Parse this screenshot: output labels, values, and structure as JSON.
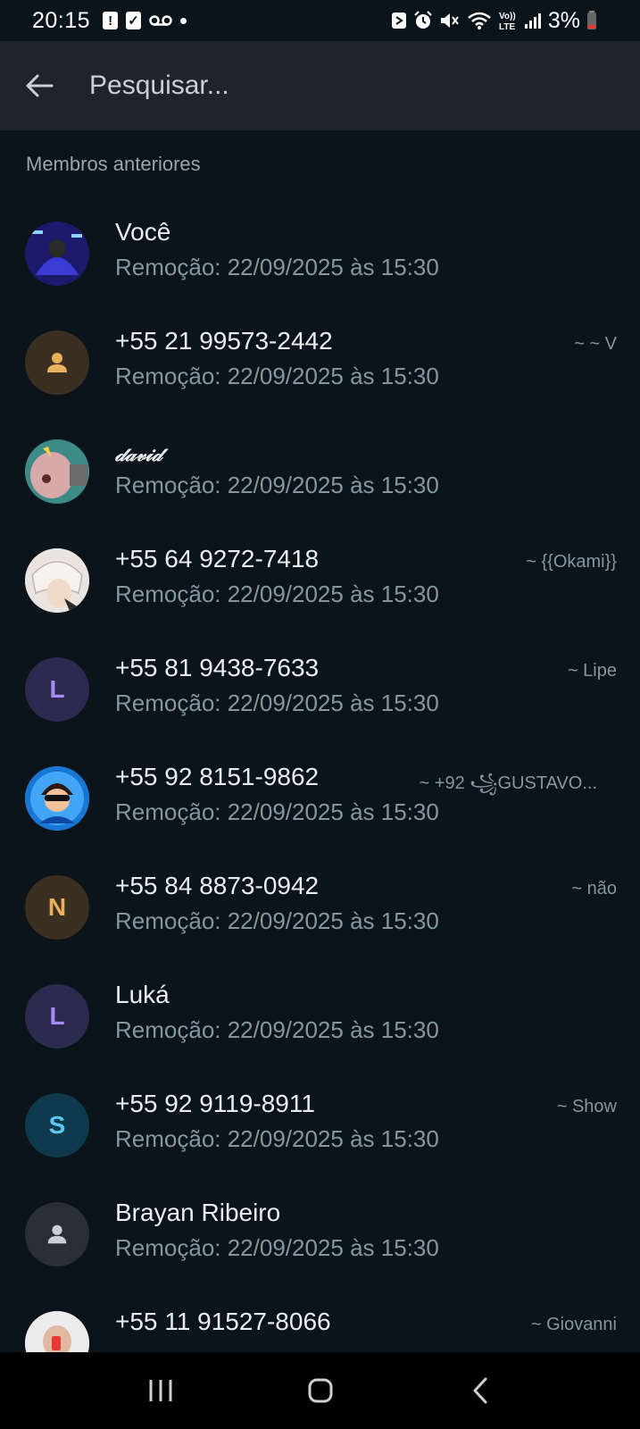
{
  "status_bar": {
    "time": "20:15",
    "battery": "3%",
    "left_icons": [
      "alert-icon",
      "checkbox-icon",
      "voicemail-icon",
      "dot-icon"
    ],
    "right_icons": [
      "nfc-icon",
      "alarm-icon",
      "mute-icon",
      "wifi-icon",
      "volte-icon",
      "signal-icon",
      "battery-icon"
    ]
  },
  "search": {
    "placeholder": "Pesquisar..."
  },
  "section": {
    "title": "Membros anteriores"
  },
  "members": [
    {
      "name": "Você",
      "subtitle": "Remoção: 22/09/2025 às 15:30",
      "alias": "",
      "avatar": "photo-icon"
    },
    {
      "name": "+55 21 99573-2442",
      "subtitle": "Remoção: 22/09/2025 às 15:30",
      "alias": "~ ~ V",
      "avatar": "person-icon"
    },
    {
      "name": "𝒹𝒶𝓋𝒾𝒹",
      "subtitle": "Remoção: 22/09/2025 às 15:30",
      "alias": "",
      "avatar": "photo-icon"
    },
    {
      "name": "+55 64 9272-7418",
      "subtitle": "Remoção: 22/09/2025 às 15:30",
      "alias": "~ {{Okami}}",
      "avatar": "photo-icon"
    },
    {
      "name": "+55 81 9438-7633",
      "subtitle": "Remoção: 22/09/2025 às 15:30",
      "alias": "~ Lipe",
      "avatar_letter": "L"
    },
    {
      "name": "+55 92 8151-9862",
      "subtitle": "Remoção: 22/09/2025 às 15:30",
      "alias": "~ +92 ꧁GUSTAVO...",
      "avatar": "photo-icon"
    },
    {
      "name": "+55 84 8873-0942",
      "subtitle": "Remoção: 22/09/2025 às 15:30",
      "alias": "~ não",
      "avatar_letter": "N"
    },
    {
      "name": "Luká",
      "subtitle": "Remoção: 22/09/2025 às 15:30",
      "alias": "",
      "avatar_letter": "L"
    },
    {
      "name": "+55 92 9119-8911",
      "subtitle": "Remoção: 22/09/2025 às 15:30",
      "alias": "~ Show",
      "avatar_letter": "S"
    },
    {
      "name": "Brayan Ribeiro",
      "subtitle": "Remoção: 22/09/2025 às 15:30",
      "alias": "",
      "avatar": "person-icon"
    },
    {
      "name": "+55 11 91527-8066",
      "subtitle": "",
      "alias": "~ Giovanni",
      "avatar": "photo-icon"
    }
  ],
  "nav": {
    "icons": [
      "recents-icon",
      "home-icon",
      "back-icon"
    ]
  },
  "colors": {
    "background": "#0b141a",
    "header": "#1f2428",
    "secondary_text": "#8696a0"
  }
}
